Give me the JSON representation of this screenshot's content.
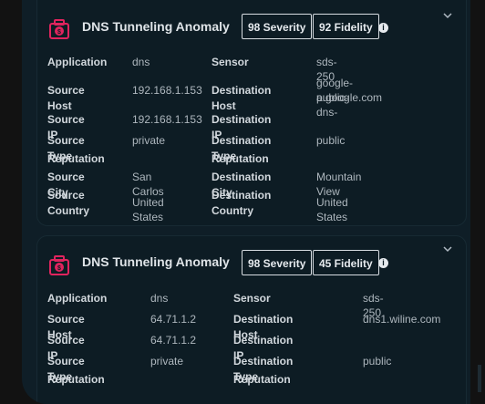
{
  "alerts": [
    {
      "title": "DNS Tunneling Anomaly",
      "severity": "98 Severity",
      "fidelity": "92 Fidelity",
      "fields": {
        "application_label": "Application",
        "application": "dns",
        "sensor_label": "Sensor",
        "sensor": "sds-250",
        "source_host_label": "Source Host",
        "source_host": "192.168.1.153",
        "destination_host_label": "Destination Host",
        "destination_host_line1": "google-public-dns-",
        "destination_host_line2": "a.google.com",
        "source_ip_label": "Source IP",
        "source_ip": "192.168.1.153",
        "destination_ip_label": "Destination IP",
        "destination_ip": "",
        "source_type_label_1": "Source Type",
        "source_type_label_2": "Reputation",
        "source_type": "private",
        "destination_type_label_1": "Destination Type",
        "destination_type_label_2": "Reputation",
        "destination_type": "public",
        "source_city_label": "Source City",
        "source_city": "San Carlos",
        "destination_city_label": "Destination City",
        "destination_city": "Mountain View",
        "source_country_label_1": "Source",
        "source_country_label_2": "Country",
        "source_country": "United States",
        "destination_country_label_1": "Destination",
        "destination_country_label_2": "Country",
        "destination_country": "United States"
      }
    },
    {
      "title": "DNS Tunneling Anomaly",
      "severity": "98 Severity",
      "fidelity": "45 Fidelity",
      "fields": {
        "application_label": "Application",
        "application": "dns",
        "sensor_label": "Sensor",
        "sensor": "sds-250",
        "source_host_label": "Source Host",
        "source_host": "64.71.1.2",
        "destination_host_label": "Destination Host",
        "destination_host": "dns1.wiline.com",
        "source_ip_label": "Source IP",
        "source_ip": "64.71.1.2",
        "destination_ip_label": "Destination IP",
        "destination_ip": "",
        "source_type_label_1": "Source Type",
        "source_type_label_2": "Reputation",
        "source_type": "private",
        "destination_type_label_1": "Destination Type",
        "destination_type_label_2": "Reputation",
        "destination_type": "public"
      }
    }
  ],
  "icons": {
    "alert": "alert-camera-icon",
    "info": "info-icon",
    "expand": "chevron-down-icon"
  },
  "colors": {
    "alert_icon": "#e0245e",
    "panel_bg": "#0f1e27",
    "card_bg": "#0d1c24"
  },
  "info_glyph": "i",
  "chevron_glyph": "⌄"
}
